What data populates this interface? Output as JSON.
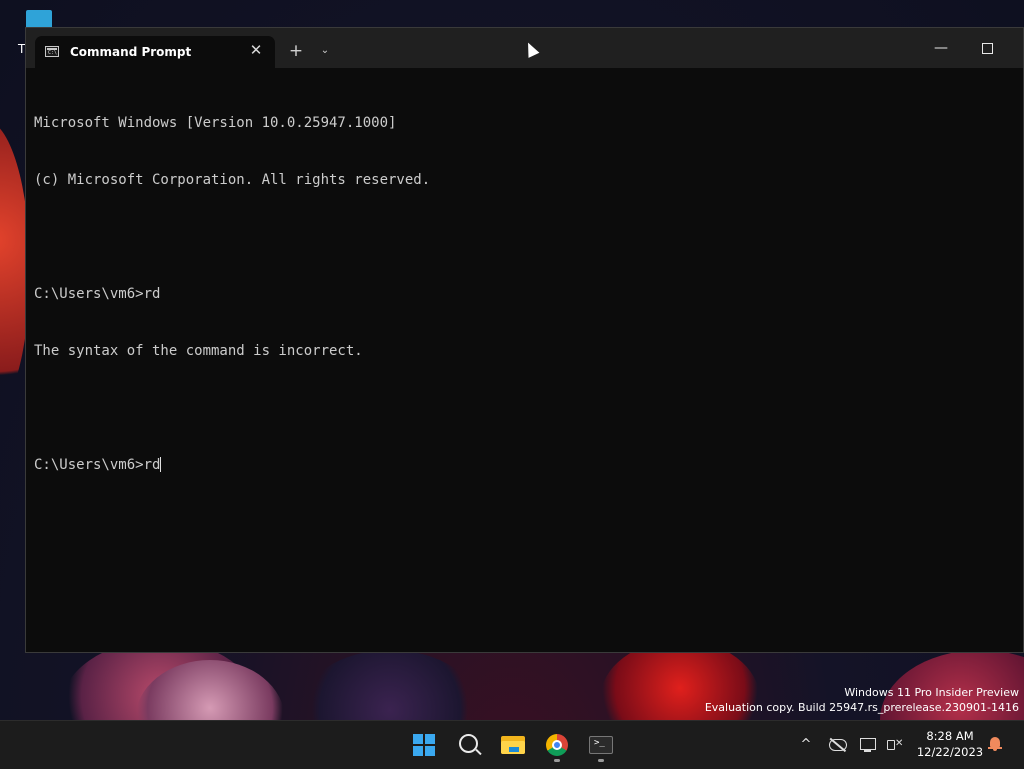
{
  "window": {
    "tab_title": "Command Prompt",
    "tab_close_glyph": "✕",
    "new_tab_glyph": "+",
    "dropdown_glyph": "⌄",
    "minimize_glyph": "—",
    "tab_icon": "cmd-icon",
    "tab_icon_text": "C:\\"
  },
  "console": {
    "lines": [
      "Microsoft Windows [Version 10.0.25947.1000]",
      "(c) Microsoft Corporation. All rights reserved.",
      "",
      "C:\\Users\\vm6>rd",
      "The syntax of the command is incorrect.",
      "",
      "C:\\Users\\vm6>rd"
    ]
  },
  "desktop": {
    "icon_label_fragment": "T"
  },
  "watermark": {
    "line1": "Windows 11 Pro Insider Preview",
    "line2": "Evaluation copy. Build 25947.rs_prerelease.230901-1416"
  },
  "taskbar": {
    "apps": [
      "start-icon",
      "search-icon",
      "file-explorer-icon",
      "chrome-icon",
      "terminal-icon"
    ],
    "terminal_icon_text": ">_",
    "tray_chevron": "^",
    "volume_mute_glyph": "✕",
    "time": "8:28 AM",
    "date": "12/22/2023"
  },
  "colors": {
    "console_bg": "#0c0c0c",
    "console_fg": "#cccccc",
    "titlebar_bg": "#202020",
    "taskbar_bg": "#1c1c1c",
    "start_blue": "#3aa8f0"
  }
}
